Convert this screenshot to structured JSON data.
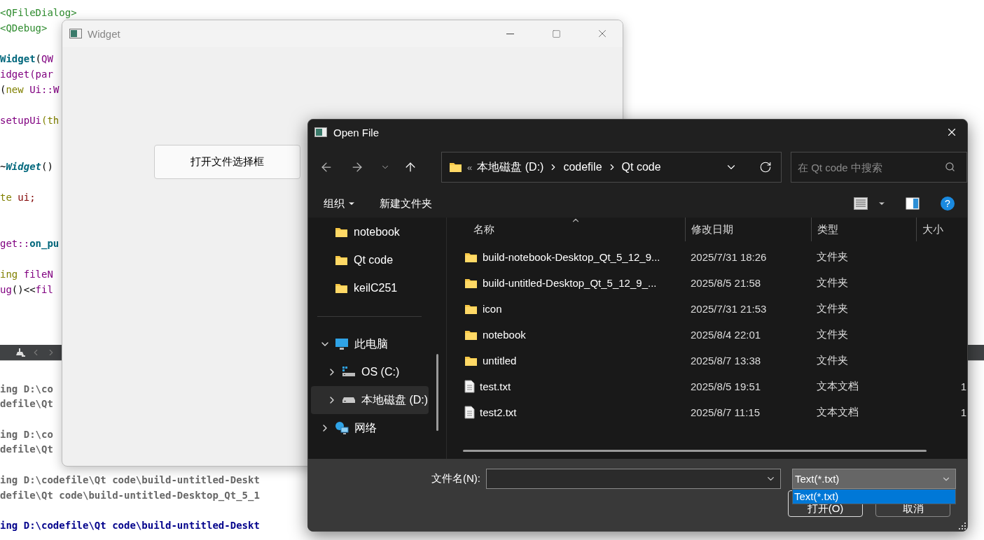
{
  "ide": {
    "code_lines": [
      {
        "kind": "code",
        "segments": [
          {
            "text": "<QFileDialog>",
            "kind": "include"
          }
        ]
      },
      {
        "kind": "code",
        "segments": [
          {
            "text": "<QDebug>",
            "kind": "include"
          }
        ]
      },
      {
        "kind": "blank"
      },
      {
        "kind": "code",
        "segments": [
          {
            "text": "Widget",
            "kind": "func"
          },
          {
            "text": "(",
            "kind": "plain"
          },
          {
            "text": "QW",
            "kind": "type"
          }
        ]
      },
      {
        "kind": "code",
        "segments": [
          {
            "text": "idget(par",
            "kind": "type"
          }
        ]
      },
      {
        "kind": "code",
        "segments": [
          {
            "text": "(",
            "kind": "plain"
          },
          {
            "text": "new",
            "kind": "keyword"
          },
          {
            "text": " Ui::W",
            "kind": "type"
          }
        ]
      },
      {
        "kind": "blank"
      },
      {
        "kind": "code",
        "segments": [
          {
            "text": "setupUi",
            "kind": "type"
          },
          {
            "text": "(th",
            "kind": "keyword"
          }
        ]
      },
      {
        "kind": "blank"
      },
      {
        "kind": "blank"
      },
      {
        "kind": "code",
        "segments": [
          {
            "text": "~",
            "kind": "plain"
          },
          {
            "text": "Widget",
            "kind": "func_italic"
          },
          {
            "text": "()",
            "kind": "plain"
          }
        ]
      },
      {
        "kind": "blank"
      },
      {
        "kind": "code",
        "segments": [
          {
            "text": "te",
            "kind": "keyword"
          },
          {
            "text": " ui;",
            "kind": "member"
          }
        ]
      },
      {
        "kind": "blank"
      },
      {
        "kind": "blank"
      },
      {
        "kind": "code",
        "segments": [
          {
            "text": "get::",
            "kind": "type"
          },
          {
            "text": "on_pu",
            "kind": "func"
          }
        ]
      },
      {
        "kind": "blank"
      },
      {
        "kind": "code",
        "segments": [
          {
            "text": "ing",
            "kind": "keyword"
          },
          {
            "text": " fileN",
            "kind": "type"
          }
        ]
      },
      {
        "kind": "code",
        "segments": [
          {
            "text": "ug",
            "kind": "type"
          },
          {
            "text": "()<<",
            "kind": "plain"
          },
          {
            "text": "fil",
            "kind": "type"
          }
        ]
      }
    ],
    "output_lines": [
      {
        "kind": "blank"
      },
      {
        "kind": "info",
        "text": "ing D:\\co"
      },
      {
        "kind": "info",
        "text": "defile\\Qt"
      },
      {
        "kind": "blank"
      },
      {
        "kind": "info",
        "text": "ing D:\\co"
      },
      {
        "kind": "info",
        "text": "defile\\Qt"
      },
      {
        "kind": "blank"
      },
      {
        "kind": "info",
        "text": "ing D:\\codefile\\Qt code\\build-untitled-Deskt"
      },
      {
        "kind": "info",
        "text": "defile\\Qt code\\build-untitled-Desktop_Qt_5_1"
      },
      {
        "kind": "blank"
      },
      {
        "kind": "start",
        "text": "ing D:\\codefile\\Qt code\\build-untitled-Deskt"
      }
    ]
  },
  "widget_window": {
    "title": "Widget",
    "button": "打开文件选择框"
  },
  "dialog": {
    "title": "Open File",
    "crumb_overflow": "«",
    "breadcrumb": [
      "本地磁盘 (D:)",
      "codefile",
      "Qt code"
    ],
    "search": {
      "placeholder": "在 Qt code 中搜索"
    },
    "help_glyph": "?",
    "commands": [
      {
        "label": "组织",
        "menu": true
      },
      {
        "label": "新建文件夹",
        "menu": false
      }
    ],
    "nav": [
      [
        {
          "label": "notebook",
          "kind": "folder",
          "selected": false
        },
        {
          "label": "Qt code",
          "kind": "folder",
          "selected": false
        },
        {
          "label": "keilC251",
          "kind": "folder",
          "selected": false
        }
      ],
      [
        {
          "label": "此电脑",
          "kind": "pc",
          "selected": false,
          "expanded": true,
          "children": [
            {
              "label": "OS (C:)",
              "kind": "system_drive",
              "selected": false,
              "expanded": false
            },
            {
              "label": "本地磁盘 (D:)",
              "kind": "drive",
              "selected": true,
              "expanded": false
            }
          ]
        },
        {
          "label": "网络",
          "kind": "network",
          "selected": false,
          "expanded": false
        }
      ]
    ],
    "columns": [
      "名称",
      "修改日期",
      "类型",
      "大小"
    ],
    "rows": [
      {
        "kind": "folder",
        "name": "build-notebook-Desktop_Qt_5_12_9...",
        "date": "2025/7/31 18:26",
        "type": "文件夹"
      },
      {
        "kind": "folder",
        "name": "build-untitled-Desktop_Qt_5_12_9_...",
        "date": "2025/8/5 21:58",
        "type": "文件夹"
      },
      {
        "kind": "folder",
        "name": "icon",
        "date": "2025/7/31 21:53",
        "type": "文件夹"
      },
      {
        "kind": "folder",
        "name": "notebook",
        "date": "2025/8/4 22:01",
        "type": "文件夹"
      },
      {
        "kind": "folder",
        "name": "untitled",
        "date": "2025/8/7 13:38",
        "type": "文件夹"
      },
      {
        "kind": "file",
        "name": "test.txt",
        "date": "2025/8/5 19:51",
        "type": "文本文档",
        "size": "1"
      },
      {
        "kind": "file",
        "name": "test2.txt",
        "date": "2025/8/7 11:15",
        "type": "文本文档",
        "size": "1"
      }
    ],
    "filename_label": "文件名(N):",
    "filetype": "Text(*.txt)",
    "filetype_options": [
      {
        "label": "Text(*.txt)",
        "selected": true
      }
    ],
    "buttons": [
      "打开(O)",
      "取消"
    ]
  }
}
